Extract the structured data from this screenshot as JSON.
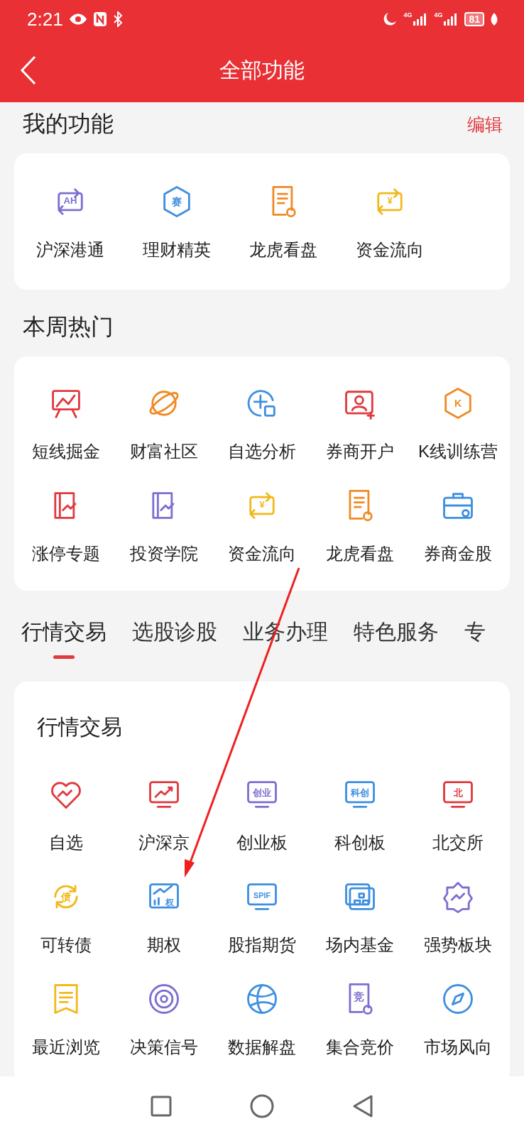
{
  "status_bar": {
    "time": "2:21",
    "signals": [
      "4G",
      "4G"
    ],
    "battery": "81"
  },
  "header": {
    "title": "全部功能"
  },
  "my_functions": {
    "title": "我的功能",
    "edit": "编辑",
    "items": [
      {
        "label": "沪深港通",
        "kind": "swap",
        "glyph": "AH",
        "color": "#7b6fd0"
      },
      {
        "label": "理财精英",
        "kind": "hex",
        "glyph": "赛",
        "color": "#3d8fe0"
      },
      {
        "label": "龙虎看盘",
        "kind": "doc",
        "color": "#f08a24"
      },
      {
        "label": "资金流向",
        "kind": "swap",
        "glyph": "¥",
        "color": "#f2b81c"
      }
    ]
  },
  "weekly_hot": {
    "title": "本周热门",
    "items": [
      {
        "label": "短线掘金",
        "kind": "easel",
        "color": "#e0393e"
      },
      {
        "label": "财富社区",
        "kind": "planet",
        "color": "#f08a24"
      },
      {
        "label": "自选分析",
        "kind": "plus",
        "color": "#3d8fe0"
      },
      {
        "label": "券商开户",
        "kind": "person",
        "color": "#e0393e"
      },
      {
        "label": "K线训练营",
        "kind": "hex",
        "glyph": "K",
        "color": "#f08a24"
      },
      {
        "label": "涨停专题",
        "kind": "book",
        "color": "#e0393e"
      },
      {
        "label": "投资学院",
        "kind": "book",
        "color": "#7b6fd0"
      },
      {
        "label": "资金流向",
        "kind": "swap",
        "glyph": "¥",
        "color": "#f2b81c"
      },
      {
        "label": "龙虎看盘",
        "kind": "doc",
        "color": "#f08a24"
      },
      {
        "label": "券商金股",
        "kind": "toolbox",
        "color": "#3d8fe0"
      }
    ]
  },
  "tabs": [
    {
      "label": "行情交易",
      "selected": true
    },
    {
      "label": "选股诊股",
      "selected": false
    },
    {
      "label": "业务办理",
      "selected": false
    },
    {
      "label": "特色服务",
      "selected": false
    },
    {
      "label": "专",
      "selected": false
    }
  ],
  "market": {
    "title": "行情交易",
    "items": [
      {
        "label": "自选",
        "kind": "heart",
        "color": "#e0393e"
      },
      {
        "label": "沪深京",
        "kind": "screen",
        "color": "#e0393e"
      },
      {
        "label": "创业板",
        "kind": "screen",
        "glyph": "创业",
        "color": "#7b6fd0"
      },
      {
        "label": "科创板",
        "kind": "screen",
        "glyph": "科创",
        "color": "#3d8fe0"
      },
      {
        "label": "北交所",
        "kind": "screen",
        "glyph": "北",
        "color": "#e0393e"
      },
      {
        "label": "可转债",
        "kind": "cycle",
        "glyph": "债",
        "color": "#f2b81c"
      },
      {
        "label": "期权",
        "kind": "board",
        "glyph": "权",
        "color": "#3d8fe0"
      },
      {
        "label": "股指期货",
        "kind": "screen",
        "glyph": "SPIF",
        "color": "#3d8fe0"
      },
      {
        "label": "场内基金",
        "kind": "stack",
        "color": "#3d8fe0"
      },
      {
        "label": "强势板块",
        "kind": "puzzle",
        "color": "#7b6fd0"
      },
      {
        "label": "最近浏览",
        "kind": "note",
        "color": "#f2b81c"
      },
      {
        "label": "决策信号",
        "kind": "radar",
        "color": "#7b6fd0"
      },
      {
        "label": "数据解盘",
        "kind": "globe",
        "color": "#3d8fe0"
      },
      {
        "label": "集合竞价",
        "kind": "doc",
        "glyph": "竞",
        "color": "#7b6fd0"
      },
      {
        "label": "市场风向",
        "kind": "compass",
        "color": "#3d8fe0"
      }
    ]
  }
}
